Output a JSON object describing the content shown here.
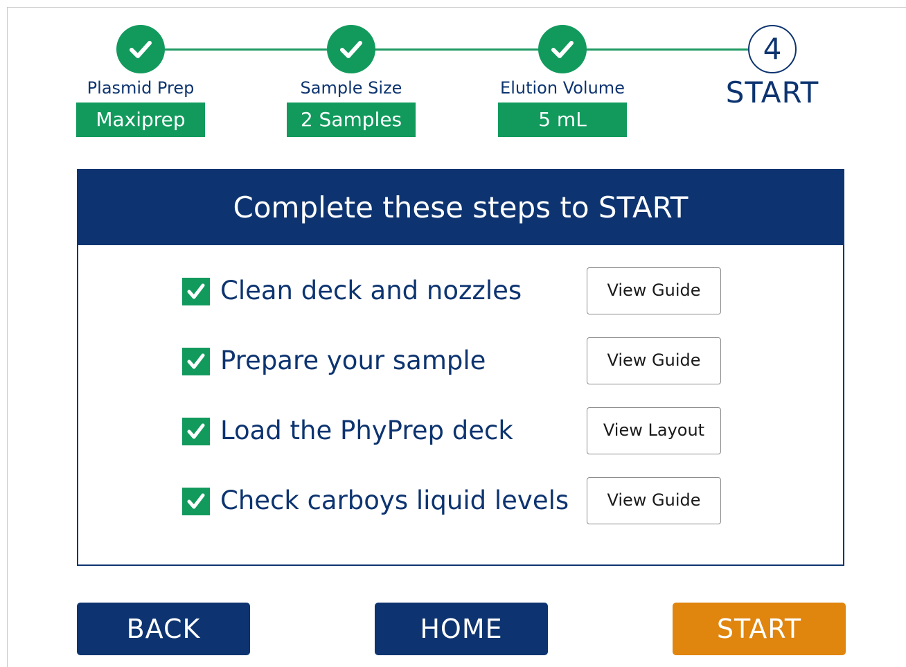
{
  "stepper": {
    "steps": [
      {
        "label": "Plasmid Prep",
        "value": "Maxiprep",
        "status": "complete"
      },
      {
        "label": "Sample Size",
        "value": "2 Samples",
        "status": "complete"
      },
      {
        "label": "Elution Volume",
        "value": "5 mL",
        "status": "complete"
      },
      {
        "number": "4",
        "label": "START",
        "status": "pending"
      }
    ]
  },
  "panel": {
    "title": "Complete these steps to START",
    "tasks": [
      {
        "label": "Clean deck and nozzles",
        "checked": true,
        "button": "View Guide"
      },
      {
        "label": "Prepare your sample",
        "checked": true,
        "button": "View Guide"
      },
      {
        "label": "Load the PhyPrep deck",
        "checked": true,
        "button": "View Layout"
      },
      {
        "label": "Check carboys liquid levels",
        "checked": true,
        "button": "View Guide"
      }
    ]
  },
  "nav": {
    "back": "BACK",
    "home": "HOME",
    "start": "START"
  },
  "colors": {
    "navy": "#0d3470",
    "green": "#129a5d",
    "orange": "#e0850e"
  }
}
